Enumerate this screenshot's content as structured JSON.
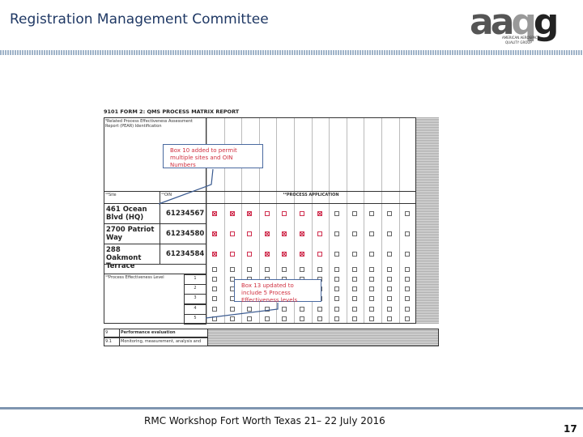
{
  "header": {
    "title": "Registration Management Committee",
    "logo_text": "aaqg",
    "logo_sub1": "AMERICAN AEROSPACE",
    "logo_sub2": "QUALITY GROUP"
  },
  "form": {
    "title": "9101 FORM 2: QMS PROCESS MATRIX REPORT",
    "pear_label": "⁹Related Process Effectiveness Assessment Report (PEAR) Identification",
    "site_label": "¹⁰Site",
    "oin_label": "¹¹OIN",
    "process_label": "¹²PROCESS APPLICATION",
    "sites": [
      {
        "name": "461 Ocean Blvd (HQ)",
        "oin": "61234567",
        "checks": [
          "x",
          "x",
          "x",
          "r",
          "r",
          "r",
          "x",
          "",
          "",
          "",
          "",
          ""
        ]
      },
      {
        "name": "2700 Patriot Way",
        "oin": "61234580",
        "checks": [
          "x",
          "r",
          "r",
          "x",
          "x",
          "x",
          "r",
          "",
          "",
          "",
          "",
          ""
        ]
      },
      {
        "name": "288 Oakmont Terrace",
        "oin": "61234584",
        "checks": [
          "x",
          "r",
          "r",
          "x",
          "x",
          "x",
          "r",
          "",
          "",
          "",
          "",
          ""
        ]
      }
    ],
    "pe_label": "¹³Process Effectiveness Level",
    "pe_levels": [
      "1",
      "2",
      "3",
      "4",
      "5"
    ],
    "bottom_rows": [
      {
        "num": "9",
        "label": "Performance evaluation"
      },
      {
        "num": "9.1",
        "label": "Monitoring, measurement, analysis and"
      }
    ],
    "callout1": "Box 10 added to permit multiple sites and OIN Numbers",
    "callout2": "Box 13 updated to include 5 Process Effectiveness levels"
  },
  "footer": {
    "text": "RMC Workshop Fort Worth Texas 21– 22 July 2016",
    "page": "17"
  }
}
